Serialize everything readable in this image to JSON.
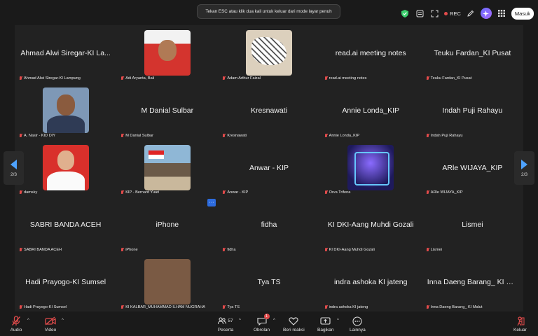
{
  "banner": {
    "text": "Tekan ESC atau klik dua kali untuk keluar dari mode layar penuh"
  },
  "topbar": {
    "rec_label": "REC",
    "signin_label": "Masuk"
  },
  "pagination": {
    "left": "2/3",
    "right": "2/3"
  },
  "tiles": [
    {
      "display": "Ahmad Alwi Siregar-KI La...",
      "label": "Ahmad Alwi Siregar-KI Lampung"
    },
    {
      "display": "",
      "label": "Adi Aryanta, Bali",
      "avatar": "av-adi"
    },
    {
      "display": "",
      "label": "Adam Arthur Faizal",
      "avatar": "av-adam"
    },
    {
      "display": "read.ai meeting notes",
      "label": "read.ai meeting notes"
    },
    {
      "display": "Teuku Fardan_KI Pusat",
      "label": "Teuku Fardan_KI Pusat"
    },
    {
      "display": "",
      "label": "A. Nasir - KID DIY",
      "avatar": "av-nasir"
    },
    {
      "display": "M Danial Sulbar",
      "label": "M Danial Sulbar"
    },
    {
      "display": "Kresnawati",
      "label": "Kresnawati"
    },
    {
      "display": "Annie Londa_KIP",
      "label": "Annie Londa_KIP"
    },
    {
      "display": "Indah Puji Rahayu",
      "label": "Indah Puji Rahayu"
    },
    {
      "display": "",
      "label": "damsky",
      "avatar": "av-damsky"
    },
    {
      "display": "",
      "label": "KIP - Bernard Yuari",
      "avatar": "av-bernard"
    },
    {
      "display": "Anwar - KIP",
      "label": "Anwar - KIP"
    },
    {
      "display": "",
      "label": "Orva Trifena",
      "avatar": "av-orva"
    },
    {
      "display": "ARle WIJAYA_KIP",
      "label": "ARle WIJAYA_KIP"
    },
    {
      "display": "SABRI BANDA ACEH",
      "label": "SABRI BANDA ACEH"
    },
    {
      "display": "iPhone",
      "label": "iPhone"
    },
    {
      "display": "fidha",
      "label": "fidha"
    },
    {
      "display": "KI DKI-Aang Muhdi Gozali",
      "label": "KI DKI-Aang Muhdi Gozali"
    },
    {
      "display": "Lismei",
      "label": "Lismei"
    },
    {
      "display": "Hadi Prayogo-KI Sumsel",
      "label": "Hadi Prayogo-KI Sumsel"
    },
    {
      "display": "",
      "label": "KI KALBAR_MUHAMMAD ILHAM NUGRAHA",
      "avatar": "av-ilham"
    },
    {
      "display": "Tya TS",
      "label": "Tya TS"
    },
    {
      "display": "indra ashoka KI jateng",
      "label": "indra ashoka KI jateng"
    },
    {
      "display": "Inna Daeng Barang_ KI M...",
      "label": "Inna Daeng Barang_ KI Malut"
    }
  ],
  "more_label": "···",
  "toolbar": {
    "audio": "Audio",
    "video": "Video",
    "participants": "Peserta",
    "participants_count": "57",
    "chat": "Obrolan",
    "chat_badge": "1",
    "react": "Beri reaksi",
    "share": "Bagikan",
    "more": "Lainnya",
    "leave": "Keluar"
  },
  "colors": {
    "accent": "#2d6cdf",
    "mute": "#e24b4b",
    "arrow": "#4ea3ff"
  }
}
